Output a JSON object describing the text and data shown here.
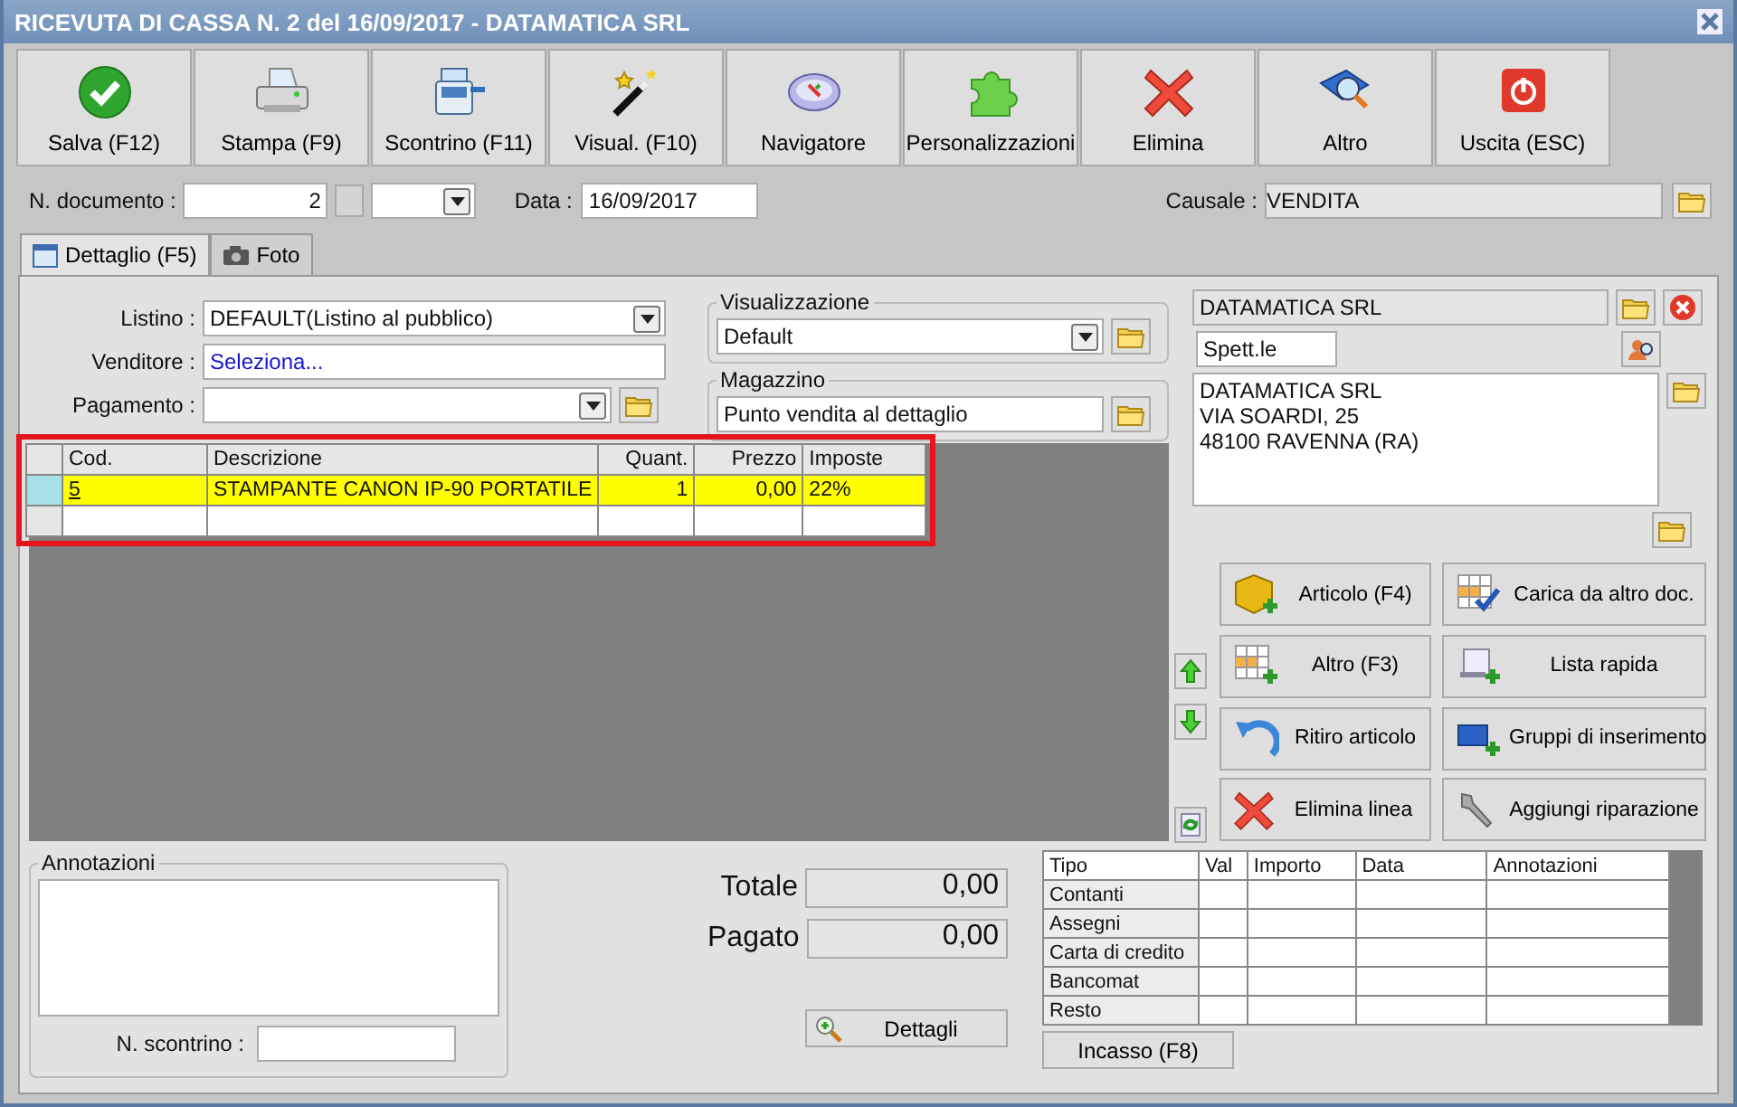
{
  "window": {
    "title": "RICEVUTA DI CASSA N. 2 del 16/09/2017 - DATAMATICA SRL"
  },
  "toolbar": [
    {
      "label": "Salva (F12)",
      "kind": "check"
    },
    {
      "label": "Stampa (F9)",
      "kind": "printer"
    },
    {
      "label": "Scontrino (F11)",
      "kind": "register"
    },
    {
      "label": "Visual. (F10)",
      "kind": "wand"
    },
    {
      "label": "Navigatore",
      "kind": "compass"
    },
    {
      "label": "Personalizzazioni",
      "kind": "puzzle"
    },
    {
      "label": "Elimina",
      "kind": "cross"
    },
    {
      "label": "Altro",
      "kind": "book"
    },
    {
      "label": "Uscita (ESC)",
      "kind": "power"
    }
  ],
  "header": {
    "doc_number_label": "N. documento :",
    "doc_number": "2",
    "date_label": "Data :",
    "date": "16/09/2017",
    "causale_label": "Causale :",
    "causale": "VENDITA"
  },
  "tabs": [
    {
      "label": "Dettaglio (F5)",
      "selected": true,
      "kind": "calendar"
    },
    {
      "label": "Foto",
      "selected": false,
      "kind": "camera"
    }
  ],
  "form": {
    "listino_label": "Listino :",
    "listino": "DEFAULT(Listino al pubblico)",
    "venditore_label": "Venditore :",
    "venditore": "Seleziona...",
    "pagamento_label": "Pagamento :"
  },
  "visualizzazione": {
    "legend": "Visualizzazione",
    "value": "Default"
  },
  "magazzino": {
    "legend": "Magazzino",
    "value": "Punto vendita al dettaglio"
  },
  "customer": {
    "name": "DATAMATICA SRL",
    "salutation": "Spett.le",
    "address": "DATAMATICA SRL\nVIA SOARDI, 25\n48100 RAVENNA (RA)"
  },
  "lines_table": {
    "highlighted": true,
    "columns": [
      "Cod.",
      "Descrizione",
      "Quant.",
      "Prezzo",
      "Imposte"
    ],
    "rows": [
      {
        "cells": [
          "5",
          "STAMPANTE CANON IP-90 PORTATILE",
          "1",
          "0,00",
          "22%"
        ],
        "selected": true
      }
    ]
  },
  "actions": [
    {
      "label": "Articolo (F4)",
      "kind": "box"
    },
    {
      "label": "Carica da altro doc.",
      "kind": "gridcheck"
    },
    {
      "label": "Altro (F3)",
      "kind": "gridplus"
    },
    {
      "label": "Lista rapida",
      "kind": "scroll"
    },
    {
      "label": "Ritiro articolo",
      "kind": "undo"
    },
    {
      "label": "Gruppi di inserimento",
      "kind": "screen"
    },
    {
      "label": "Elimina linea",
      "kind": "cross"
    },
    {
      "label": "Aggiungi riparazione",
      "kind": "wrench"
    }
  ],
  "annotazioni": {
    "legend": "Annotazioni",
    "scontrino_label": "N. scontrino :"
  },
  "totals": [
    {
      "label": "Totale",
      "value": "0,00"
    },
    {
      "label": "Pagato",
      "value": "0,00"
    }
  ],
  "dettagli_button": "Dettagli",
  "payments": {
    "columns": [
      "Tipo",
      "Val",
      "Importo",
      "Data",
      "Annotazioni"
    ],
    "rows": [
      "Contanti",
      "Assegni",
      "Carta di credito",
      "Bancomat",
      "Resto"
    ]
  },
  "incasso_button": "Incasso (F8)"
}
